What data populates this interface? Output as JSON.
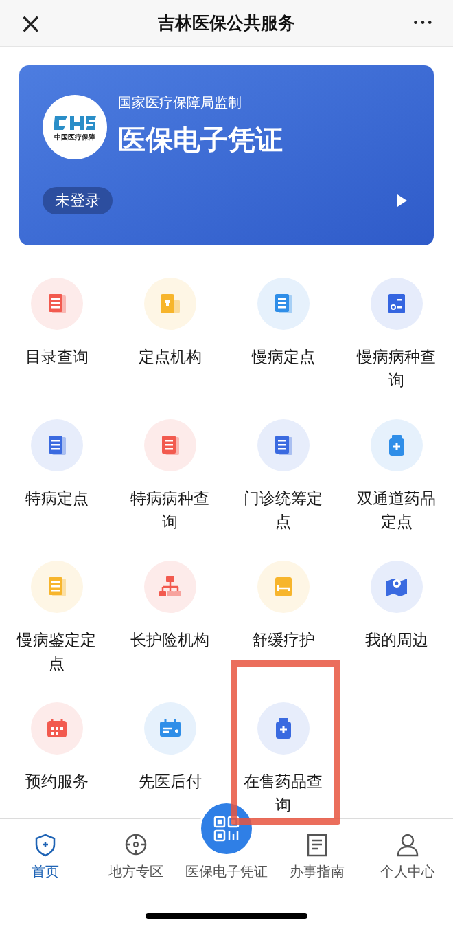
{
  "header": {
    "close": "×",
    "title": "吉林医保公共服务",
    "more": "•••"
  },
  "card": {
    "subtitle": "国家医疗保障局监制",
    "title": "医保电子凭证",
    "login": "未登录",
    "logo_text": "中国医疗保障"
  },
  "services": [
    {
      "label": "目录查询",
      "kind": "doc",
      "color": "#f25a4f"
    },
    {
      "label": "定点机构",
      "kind": "plus",
      "color": "#f7b52c"
    },
    {
      "label": "慢病定点",
      "kind": "doc",
      "color": "#2f8ee8"
    },
    {
      "label": "慢病病种查询",
      "kind": "search",
      "color": "#3565e0"
    },
    {
      "label": "特病定点",
      "kind": "doc",
      "color": "#3a6ae0"
    },
    {
      "label": "特病病种查询",
      "kind": "doc",
      "color": "#f25a4f"
    },
    {
      "label": "门诊统筹定点",
      "kind": "doc",
      "color": "#3a6ae0"
    },
    {
      "label": "双通道药品定点",
      "kind": "bottle",
      "color": "#2f8ee8"
    },
    {
      "label": "慢病鉴定定点",
      "kind": "doc",
      "color": "#f7b52c"
    },
    {
      "label": "长护险机构",
      "kind": "tree",
      "color": "#f25a4f"
    },
    {
      "label": "舒缓疗护",
      "kind": "bed",
      "color": "#f7b52c"
    },
    {
      "label": "我的周边",
      "kind": "map",
      "color": "#3a6ae0"
    },
    {
      "label": "预约服务",
      "kind": "calendar",
      "color": "#f25a4f"
    },
    {
      "label": "先医后付",
      "kind": "card",
      "color": "#2f8ee8"
    },
    {
      "label": "在售药品查询",
      "kind": "bottle",
      "color": "#3a6ae0"
    }
  ],
  "tabbar": [
    {
      "label": "首页",
      "kind": "shield",
      "selected": true
    },
    {
      "label": "地方专区",
      "kind": "target",
      "selected": false
    },
    {
      "label": "医保电子凭证",
      "kind": "qr",
      "selected": false
    },
    {
      "label": "办事指南",
      "kind": "doc",
      "selected": false
    },
    {
      "label": "个人中心",
      "kind": "person",
      "selected": false
    }
  ]
}
